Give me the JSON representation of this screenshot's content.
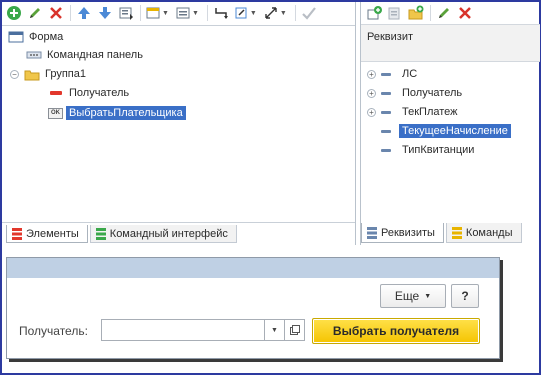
{
  "left_panel": {
    "tree": {
      "root": "Форма",
      "command_bar": "Командная панель",
      "group": "Группа1",
      "field": "Получатель",
      "button": "ВыбратьПлательщика",
      "button_badge": "OK"
    },
    "tabs": [
      "Элементы",
      "Командный интерфейс"
    ]
  },
  "right_panel": {
    "header": "Реквизит",
    "items": [
      "ЛС",
      "Получатель",
      "ТекПлатеж",
      "ТекущееНачисление",
      "ТипКвитанции"
    ],
    "tabs": [
      "Реквизиты",
      "Команды"
    ]
  },
  "preview": {
    "more_label": "Еще",
    "help_label": "?",
    "field_label": "Получатель:",
    "field_value": "",
    "select_button": "Выбрать получателя"
  },
  "colors": {
    "frame": "#2d3aa0",
    "selection": "#3a6fc7",
    "titlebar": "#bfd0e4",
    "accent_button": "#f5c400"
  }
}
